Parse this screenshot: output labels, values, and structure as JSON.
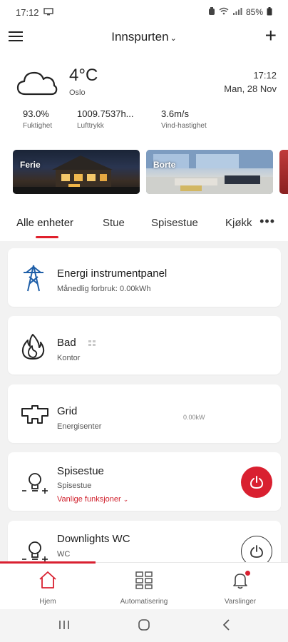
{
  "status_bar": {
    "time": "17:12",
    "battery": "85%",
    "icons": [
      "screen-icon",
      "alarm-icon",
      "wifi-icon",
      "signal-icon",
      "battery-icon"
    ]
  },
  "header": {
    "home_name": "Innspurten",
    "menu_icon": "hamburger-icon",
    "add_icon": "plus-icon"
  },
  "weather": {
    "icon": "cloud-icon",
    "temperature": "4°C",
    "city": "Oslo",
    "time": "17:12",
    "date": "Man, 28 Nov",
    "metrics": [
      {
        "value": "93.0%",
        "label": "Fuktighet"
      },
      {
        "value": "1009.7537h...",
        "label": "Lufttrykk"
      },
      {
        "value": "3.6m/s",
        "label": "Vind-hastighet"
      }
    ]
  },
  "scenes": [
    {
      "label": "Ferie"
    },
    {
      "label": "Borte"
    }
  ],
  "tabs": {
    "items": [
      {
        "label": "Alle enheter",
        "active": true
      },
      {
        "label": "Stue",
        "active": false
      },
      {
        "label": "Spisestue",
        "active": false
      },
      {
        "label": "Kjøkk",
        "active": false
      }
    ],
    "more": "•••",
    "accent_color": "#e0202c"
  },
  "devices": [
    {
      "title": "Energi instrumentpanel",
      "subtitle": "Månedlig forbruk: 0.00kWh",
      "icon": "energy-tower-icon"
    },
    {
      "title": "Bad",
      "subtitle": "Kontor",
      "icon": "flame-icon",
      "badge_icon": "offline-icon"
    },
    {
      "title": "Grid",
      "subtitle": "Energisenter",
      "value": "0.00kW",
      "icon": "grid-plug-icon"
    },
    {
      "title": "Spisestue",
      "subtitle": "Spisestue",
      "functions": "Vanlige funksjoner",
      "icon": "bulb-icon",
      "power": "on"
    },
    {
      "title": "Downlights WC",
      "subtitle": "WC",
      "icon": "bulb-icon",
      "power": "off"
    }
  ],
  "bottom_nav": [
    {
      "label": "Hjem",
      "icon": "home-icon",
      "active": true
    },
    {
      "label": "Automatisering",
      "icon": "automation-grid-icon",
      "active": false
    },
    {
      "label": "Varslinger",
      "icon": "bell-icon",
      "active": false
    }
  ],
  "system_nav": [
    "recents-icon",
    "home-circle-icon",
    "back-icon"
  ],
  "colors": {
    "accent": "#d92030",
    "background": "#f2f2f2",
    "card": "#ffffff"
  }
}
